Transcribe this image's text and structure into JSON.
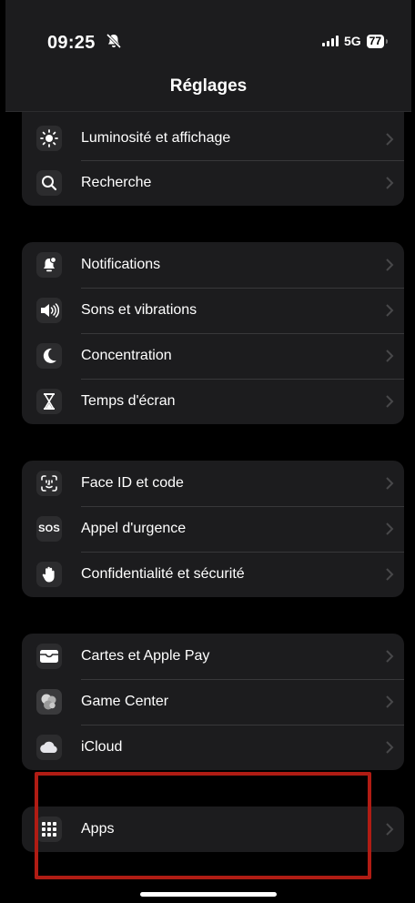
{
  "status_bar": {
    "time": "09:25",
    "network": "5G",
    "battery": "77"
  },
  "header": {
    "title": "Réglages"
  },
  "groups": [
    {
      "rows": [
        {
          "label": "Luminosité et affichage",
          "icon": "sun-icon"
        },
        {
          "label": "Recherche",
          "icon": "search-icon"
        }
      ]
    },
    {
      "rows": [
        {
          "label": "Notifications",
          "icon": "notification-bell-icon"
        },
        {
          "label": "Sons et vibrations",
          "icon": "speaker-icon"
        },
        {
          "label": "Concentration",
          "icon": "moon-icon"
        },
        {
          "label": "Temps d'écran",
          "icon": "hourglass-icon"
        }
      ]
    },
    {
      "rows": [
        {
          "label": "Face ID et code",
          "icon": "face-id-icon"
        },
        {
          "label": "Appel d'urgence",
          "icon": "sos-icon",
          "icon_text": "SOS"
        },
        {
          "label": "Confidentialité et sécurité",
          "icon": "hand-icon"
        }
      ]
    },
    {
      "rows": [
        {
          "label": "Cartes et Apple Pay",
          "icon": "wallet-icon"
        },
        {
          "label": "Game Center",
          "icon": "game-center-icon"
        },
        {
          "label": "iCloud",
          "icon": "cloud-icon"
        }
      ]
    },
    {
      "rows": [
        {
          "label": "Apps",
          "icon": "apps-grid-icon"
        }
      ]
    }
  ],
  "colors": {
    "background": "#000000",
    "group_bg": "#1c1c1e",
    "highlight": "#b01c14"
  }
}
